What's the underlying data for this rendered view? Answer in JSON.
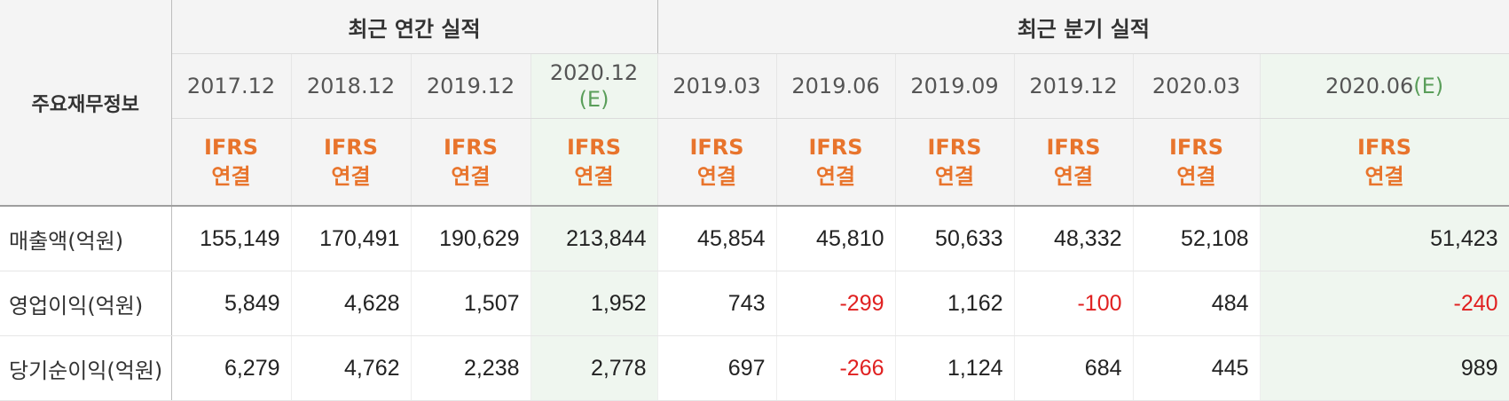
{
  "table": {
    "corner_label": "주요재무정보",
    "annual_header": "최근 연간 실적",
    "quarterly_header": "최근 분기 실적",
    "annual_periods": [
      "2017.12",
      "2018.12",
      "2019.12",
      "2020.12"
    ],
    "annual_estimate_mark": "(E)",
    "quarterly_periods": [
      "2019.03",
      "2019.06",
      "2019.09",
      "2019.12",
      "2020.03",
      "2020.06"
    ],
    "quarterly_estimate_mark": "(E)",
    "basis_line1": "IFRS",
    "basis_line2": "연결",
    "rows": [
      {
        "label": "매출액(억원)",
        "values": [
          "155,149",
          "170,491",
          "190,629",
          "213,844",
          "45,854",
          "45,810",
          "50,633",
          "48,332",
          "52,108",
          "51,423"
        ]
      },
      {
        "label": "영업이익(억원)",
        "values": [
          "5,849",
          "4,628",
          "1,507",
          "1,952",
          "743",
          "-299",
          "1,162",
          "-100",
          "484",
          "-240"
        ]
      },
      {
        "label": "당기순이익(억원)",
        "values": [
          "6,279",
          "4,762",
          "2,238",
          "2,778",
          "697",
          "-266",
          "1,124",
          "684",
          "445",
          "989"
        ]
      }
    ]
  },
  "colors": {
    "header_bg": "#f4f4f4",
    "estimate_bg": "#eff6ef",
    "ifrs_text": "#e8742c",
    "negative_text": "#e02020",
    "estimate_mark_text": "#5a9e5a"
  }
}
